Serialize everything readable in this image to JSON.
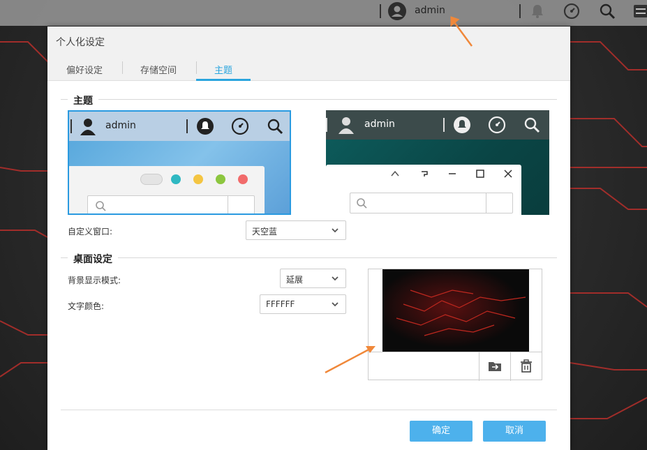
{
  "topbar": {
    "username": "admin",
    "icons": [
      "user-icon",
      "bell-icon",
      "dashboard-icon",
      "search-icon",
      "settings-icon"
    ]
  },
  "dialog": {
    "title": "个人化设定",
    "tabs": [
      {
        "label": "偏好设定",
        "active": false
      },
      {
        "label": "存储空间",
        "active": false
      },
      {
        "label": "主题",
        "active": true
      }
    ],
    "theme_section": {
      "title": "主题",
      "preview_light": {
        "username": "admin",
        "selected": true,
        "dot_colors": [
          "#2fb8c2",
          "#f4c542",
          "#8cc63f",
          "#f16b6b"
        ]
      },
      "preview_dark": {
        "username": "admin",
        "selected": false
      },
      "custom_window_label": "自定义窗口:",
      "custom_window_value": "天空蓝"
    },
    "desktop_section": {
      "title": "桌面设定",
      "bg_mode_label": "背景显示模式:",
      "bg_mode_value": "延展",
      "text_color_label": "文字颜色:",
      "text_color_value": "FFFFFF"
    },
    "buttons": {
      "ok": "确定",
      "cancel": "取消"
    }
  },
  "colors": {
    "accent": "#2aa5de",
    "button": "#4db1ec",
    "arrow": "#f0883a"
  }
}
